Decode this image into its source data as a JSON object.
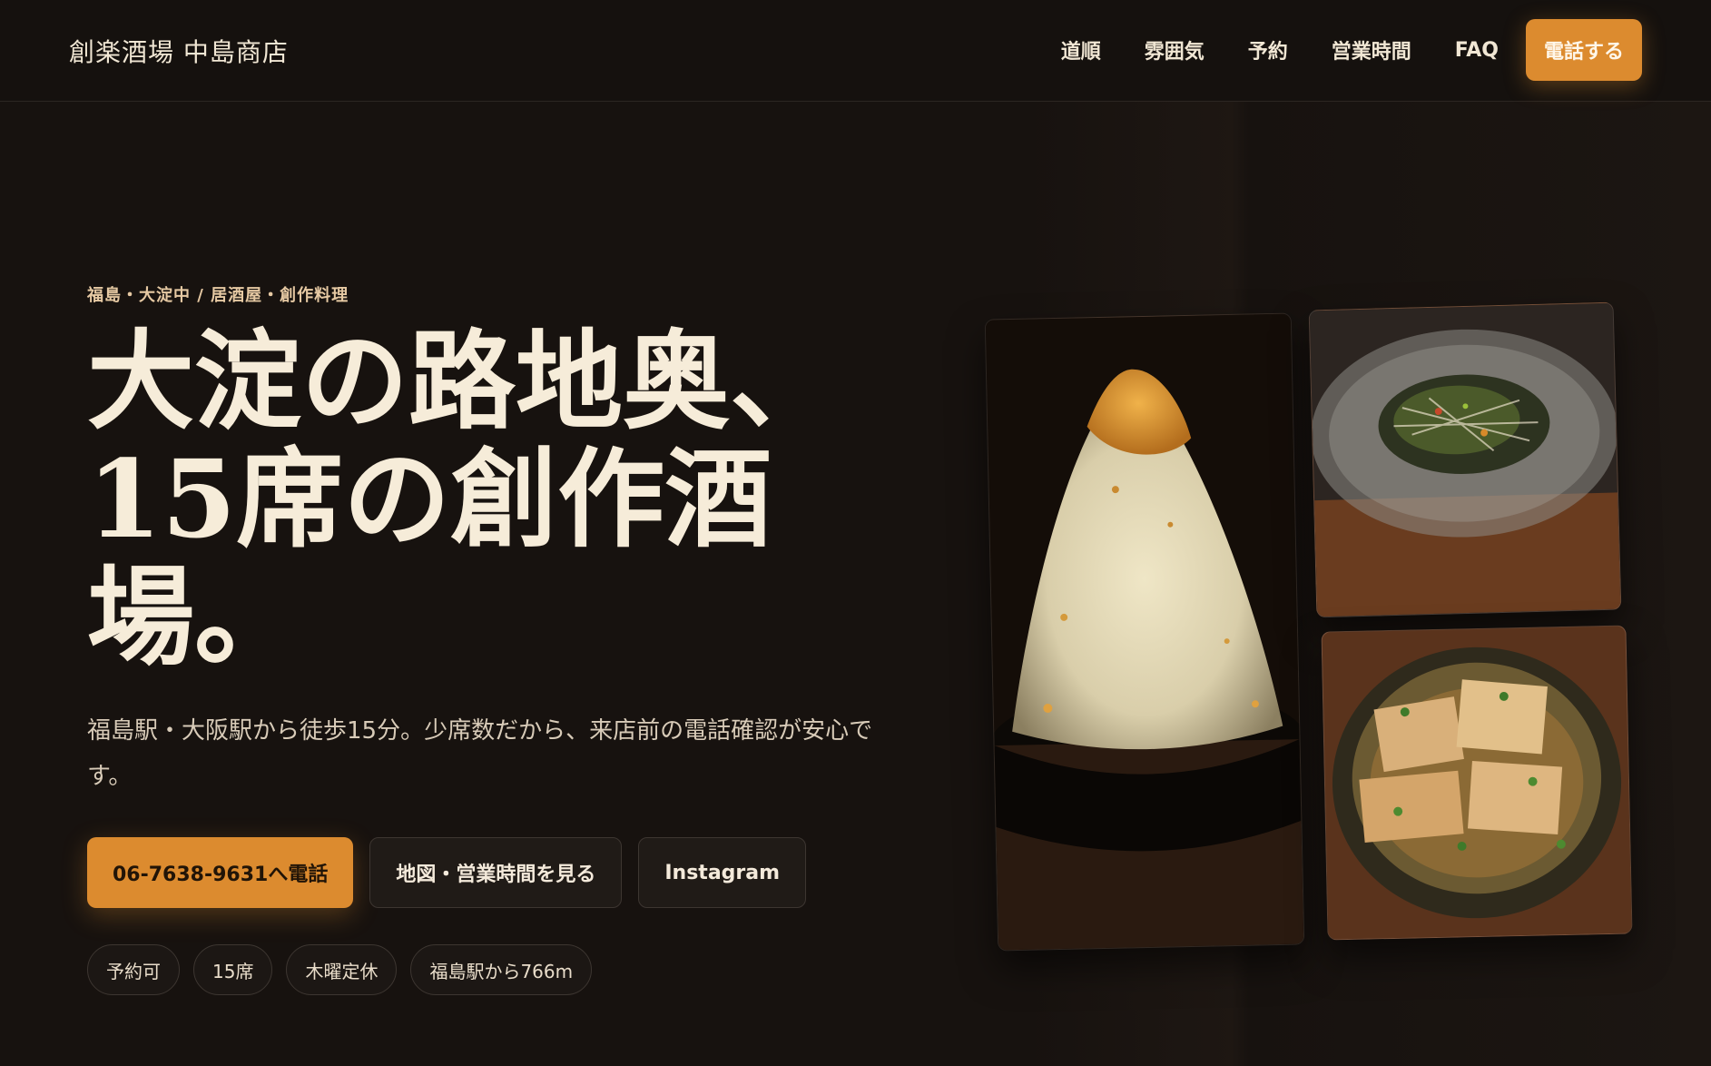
{
  "header": {
    "brand": "創楽酒場 中島商店",
    "nav": [
      {
        "label": "道順"
      },
      {
        "label": "雰囲気"
      },
      {
        "label": "予約"
      },
      {
        "label": "営業時間"
      },
      {
        "label": "FAQ"
      }
    ],
    "call_label": "電話する"
  },
  "hero": {
    "eyebrow": "福島・大淀中 / 居酒屋・創作料理",
    "headline_lines": [
      "大淀の路地奥、",
      "15席の創作酒",
      "場。"
    ],
    "lead": "福島駅・大阪駅から徒歩15分。少席数だから、来店前の電話確認が安心です。",
    "cta": {
      "primary": "06-7638-9631へ電話",
      "map": "地図・営業時間を見る",
      "instagram": "Instagram"
    },
    "tags": [
      "予約可",
      "15席",
      "木曜定休",
      "福島駅から766m"
    ]
  },
  "colors": {
    "background": "#17120f",
    "accent": "#dc8b2f",
    "text": "#f3ead8"
  }
}
